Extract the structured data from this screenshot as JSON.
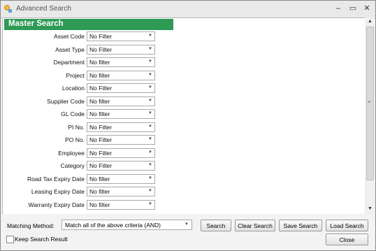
{
  "window": {
    "title": "Advanced Search"
  },
  "header": {
    "title": "Master Search"
  },
  "filter_fields": [
    {
      "label": "Asset Code",
      "value": "No Filter"
    },
    {
      "label": "Asset Type",
      "value": "No Filter"
    },
    {
      "label": "Department",
      "value": "No filter"
    },
    {
      "label": "Project",
      "value": "No filter"
    },
    {
      "label": "Location",
      "value": "No Filter"
    },
    {
      "label": "Supplier Code",
      "value": "No filter"
    },
    {
      "label": "GL Code",
      "value": "No filter"
    },
    {
      "label": "PI No.",
      "value": "No Filter"
    },
    {
      "label": "PO No.",
      "value": "No Filter"
    },
    {
      "label": "Employee",
      "value": "No Filter"
    },
    {
      "label": "Category",
      "value": "No Filter"
    },
    {
      "label": "Road Tax Expiry Date",
      "value": "No filter"
    },
    {
      "label": "Leasing Expiry Date",
      "value": "No filter"
    },
    {
      "label": "Warranty Expiry Date",
      "value": "No filter"
    }
  ],
  "bottom": {
    "matching_label": "Matching Method:",
    "matching_value": "Match all of the above criteria (AND)",
    "search_label": "Search",
    "clear_label": "Clear Search",
    "save_label": "Save Search",
    "load_label": "Load Search",
    "keep_label": "Keep Search Result",
    "close_label": "Close"
  },
  "colors": {
    "header_bg": "#2e9a54"
  },
  "icons": {
    "app": "app-icon",
    "minimize": "minimize-icon",
    "maximize": "maximize-icon",
    "close": "close-icon"
  }
}
